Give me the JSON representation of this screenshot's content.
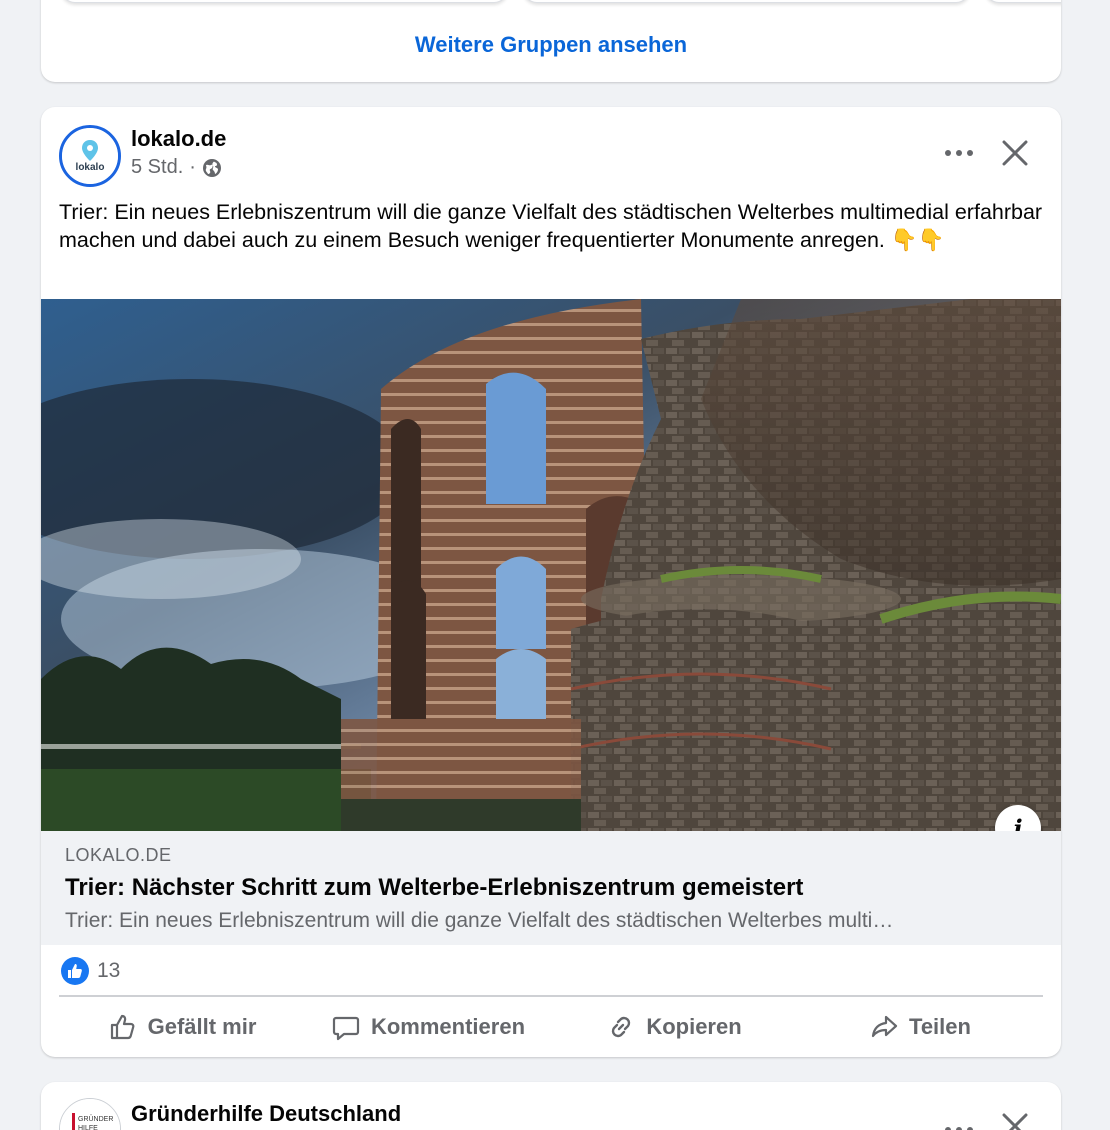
{
  "groups_section": {
    "see_more_label": "Weitere Gruppen ansehen"
  },
  "post": {
    "author": "lokalo.de",
    "avatar_text": "lokalo.de",
    "time": "5 Std.",
    "separator": "·",
    "visibility_icon": "globe-icon",
    "text": "Trier: Ein neues Erlebniszentrum will die ganze Vielfalt des städtischen Welterbes multimedial erfahrbar machen und dabei auch zu einem Besuch weniger frequentierter Monumente anregen. 👇👇",
    "link_preview": {
      "domain": "LOKALO.DE",
      "title": "Trier: Nächster Schritt zum Welterbe-Erlebniszentrum gemeistert",
      "description": "Trier: Ein neues Erlebniszentrum will die ganze Vielfalt des städtischen Welterbes multi…",
      "info_label": "i"
    },
    "reactions": {
      "count": "13",
      "type_icon": "like-icon"
    },
    "actions": {
      "like": "Gefällt mir",
      "comment": "Kommentieren",
      "copy": "Kopieren",
      "share": "Teilen"
    }
  },
  "next_post": {
    "author": "Gründerhilfe Deutschland",
    "avatar_text": "GRÜNDER HILFE"
  },
  "colors": {
    "accent": "#0a66d8",
    "like_blue": "#1877f2",
    "avatar_ring": "#1b64e0",
    "secondary_text": "#65676b",
    "background": "#f0f2f5"
  }
}
